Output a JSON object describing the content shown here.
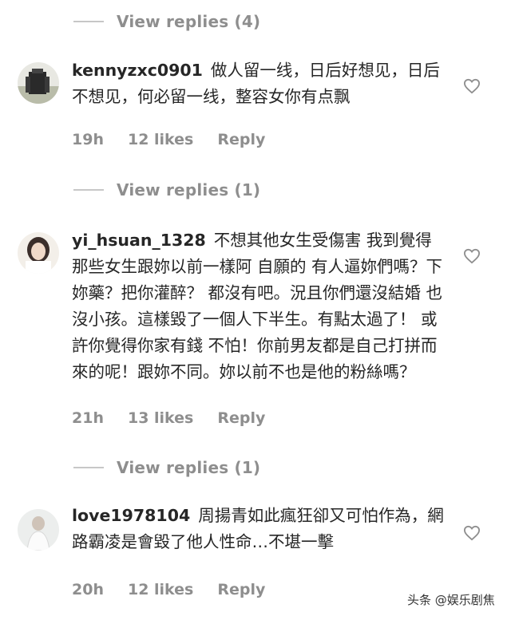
{
  "replies": [
    {
      "label": "View replies (4)"
    },
    {
      "label": "View replies (1)"
    },
    {
      "label": "View replies (1)"
    }
  ],
  "comments": [
    {
      "username": "kennyzxc0901",
      "text": "做人留一线，日后好想见，日后不想见，何必留一线，整容女你有点飘",
      "time": "19h",
      "likes": "12 likes",
      "reply": "Reply"
    },
    {
      "username": "yi_hsuan_1328",
      "text": "不想其他女生受傷害 我到覺得那些女生跟妳以前一樣阿 自願的 有人逼妳們嗎？下妳藥？把你灌醉？ 都沒有吧。況且你們還沒結婚 也沒小孩。這樣毀了一個人下半生。有點太過了！ 或許你覺得你家有錢 不怕！你前男友都是自己打拼而來的呢！跟妳不同。妳以前不也是他的粉絲嗎？",
      "time": "21h",
      "likes": "13 likes",
      "reply": "Reply"
    },
    {
      "username": "love1978104",
      "text": "周揚青如此瘋狂卻又可怕作為，網路霸凌是會毀了他人性命…不堪一擊",
      "time": "20h",
      "likes": "12 likes",
      "reply": "Reply"
    }
  ],
  "watermark": {
    "text": "头条 @娱乐剧焦"
  }
}
